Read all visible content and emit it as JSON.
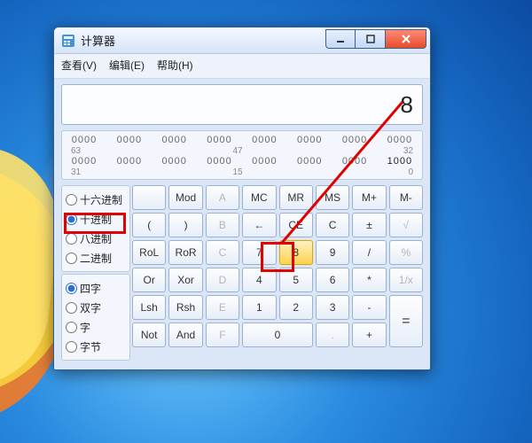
{
  "window": {
    "title": "计算器"
  },
  "menu": {
    "view": "查看(V)",
    "edit": "编辑(E)",
    "help": "帮助(H)"
  },
  "display": {
    "value": "8"
  },
  "bits": {
    "row1": [
      "0000",
      "0000",
      "0000",
      "0000",
      "0000",
      "0000",
      "0000",
      "0000"
    ],
    "labels1": {
      "left": "63",
      "mid": "47",
      "right": "32"
    },
    "row2": [
      "0000",
      "0000",
      "0000",
      "0000",
      "0000",
      "0000",
      "0000",
      "1000"
    ],
    "labels2": {
      "left": "31",
      "mid": "15",
      "right": "0"
    }
  },
  "radix": {
    "hex": "十六进制",
    "dec": "十进制",
    "oct": "八进制",
    "bin": "二进制",
    "selected": "dec"
  },
  "wordsize": {
    "qword": "四字",
    "dword": "双字",
    "word": "字",
    "byte": "字节",
    "selected": "qword"
  },
  "keys": {
    "r1": [
      "",
      "Mod",
      "A",
      "MC",
      "MR",
      "MS",
      "M+",
      "M-"
    ],
    "r2": [
      "(",
      ")",
      "B",
      "←",
      "CE",
      "C",
      "±",
      "√"
    ],
    "r3": [
      "RoL",
      "RoR",
      "C",
      "7",
      "8",
      "9",
      "/",
      "%"
    ],
    "r4": [
      "Or",
      "Xor",
      "D",
      "4",
      "5",
      "6",
      "*",
      "1/x"
    ],
    "r5": [
      "Lsh",
      "Rsh",
      "E",
      "1",
      "2",
      "3",
      "-",
      "="
    ],
    "r6": [
      "Not",
      "And",
      "F",
      "0",
      "",
      ".",
      "+",
      ""
    ]
  }
}
